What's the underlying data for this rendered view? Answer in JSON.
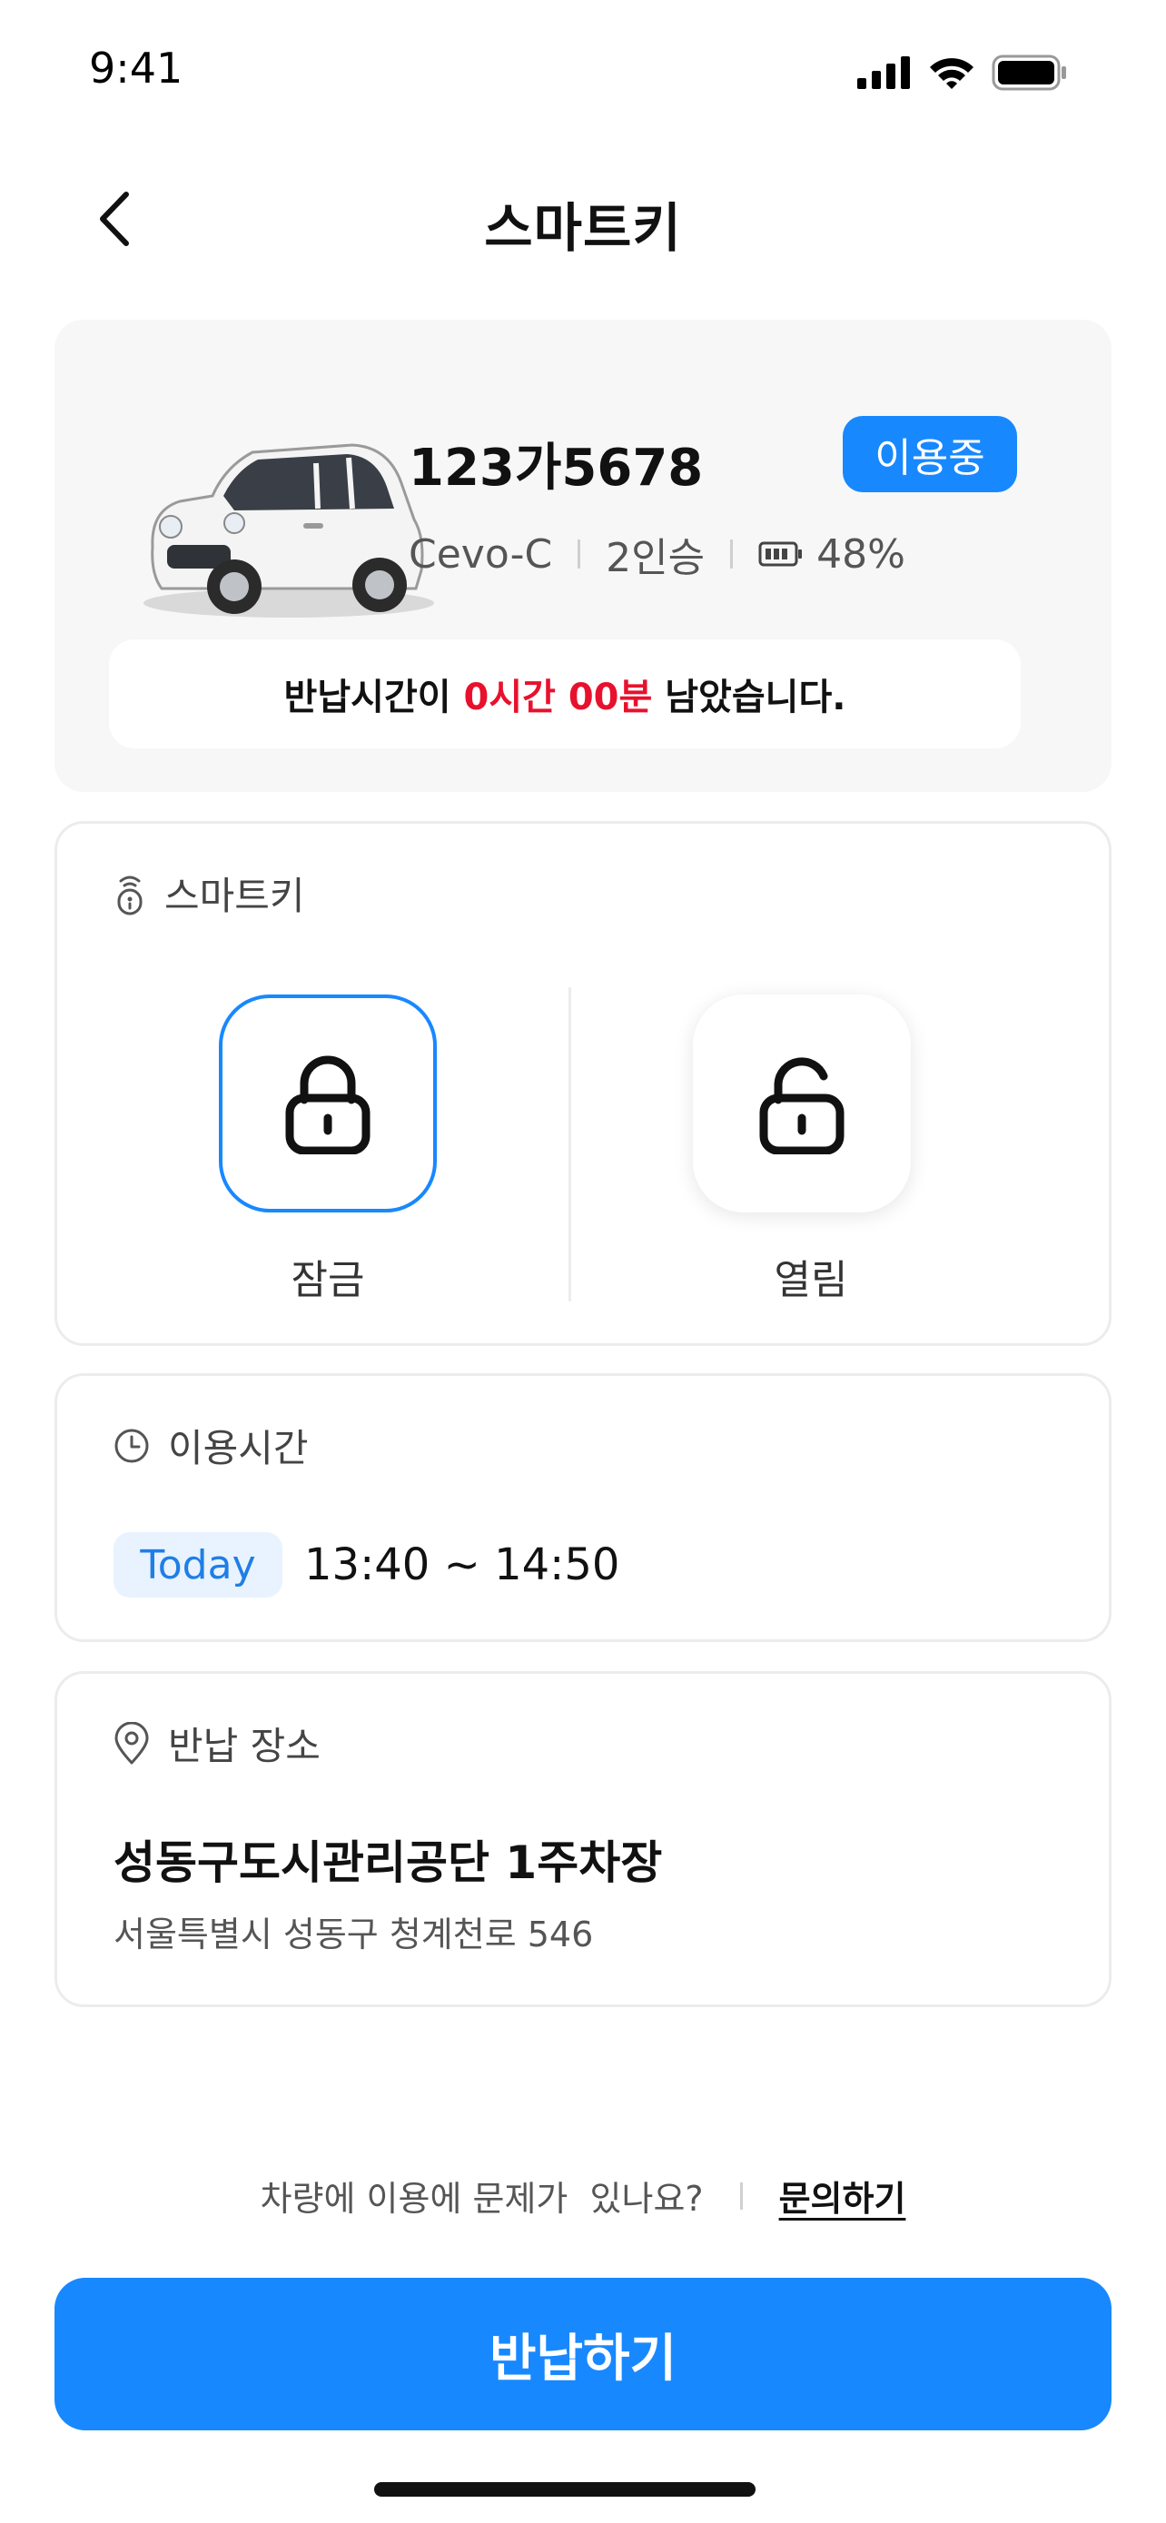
{
  "status_bar": {
    "time": "9:41"
  },
  "header": {
    "title": "스마트키"
  },
  "vehicle": {
    "plate": "123가5678",
    "status_badge": "이용중",
    "model": "Cevo-C",
    "seats": "2인승",
    "battery_percent": "48%",
    "return_notice": {
      "prefix": "반납시간이 ",
      "remaining": "0시간 00분",
      "suffix": " 남았습니다."
    }
  },
  "smartkey": {
    "title": "스마트키",
    "lock_label": "잠금",
    "unlock_label": "열림"
  },
  "usage_time": {
    "title": "이용시간",
    "day_tag": "Today",
    "range": "13:40 ~ 14:50"
  },
  "return_place": {
    "title": "반납 장소",
    "name": "성동구도시관리공단 1주차장",
    "address": "서울특별시 성동구 청계천로 546"
  },
  "inquiry": {
    "question": "차량에 이용에 문제가  있나요?",
    "link": "문의하기"
  },
  "return_button": {
    "label": "반납하기"
  },
  "colors": {
    "accent": "#1888ff",
    "alert": "#e8112d",
    "card_bg": "#f7f7f7",
    "tag_bg": "#e8f3ff"
  }
}
